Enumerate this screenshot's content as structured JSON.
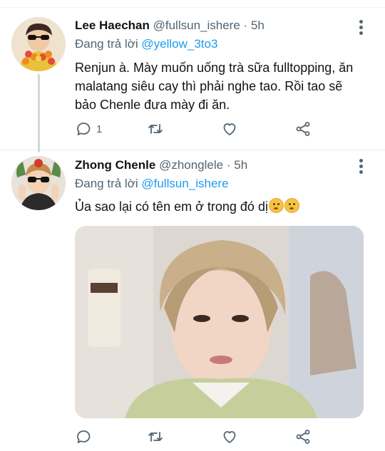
{
  "tweets": [
    {
      "display_name": "Lee Haechan",
      "handle": "@fullsun_ishere",
      "separator": "·",
      "time": "5h",
      "reply_prefix": "Đang trả lời",
      "reply_to": "@yellow_3to3",
      "text": "Renjun à. Mày muốn uống trà sữa fulltopping, ăn malatang siêu cay thì phải nghe tao. Rồi tao sẽ bảo Chenle đưa mày đi ăn.",
      "reply_count": "1",
      "icons": {
        "reply": "comment-icon",
        "retweet": "retweet-icon",
        "like": "heart-icon",
        "share": "share-icon",
        "more": "more-vertical-icon"
      }
    },
    {
      "display_name": "Zhong Chenle",
      "handle": "@zhonglele",
      "separator": "·",
      "time": "5h",
      "reply_prefix": "Đang trả lời",
      "reply_to": "@fullsun_ishere",
      "text": "Ủa sao lại có tên em ở trong đó dị",
      "emoji": [
        "woozy-face-emoji",
        "woozy-face-emoji"
      ],
      "media": "photo of a person with light brown hair",
      "icons": {
        "reply": "comment-icon",
        "retweet": "retweet-icon",
        "like": "heart-icon",
        "share": "share-icon",
        "more": "more-vertical-icon"
      }
    }
  ],
  "colors": {
    "link": "#1d9bf0",
    "secondary": "#536471",
    "text": "#0f1419",
    "thread_line": "#cfd9de"
  }
}
